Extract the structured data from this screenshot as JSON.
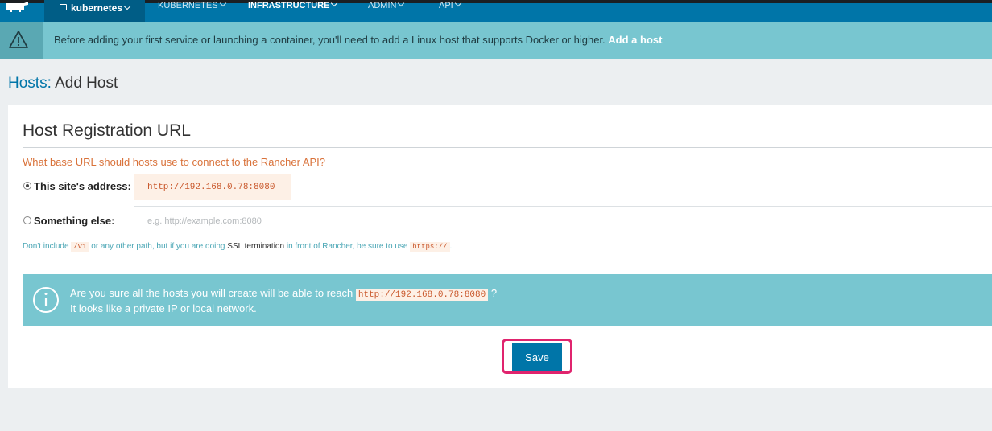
{
  "topnav": {
    "environment": "kubernetes",
    "items": [
      "KUBERNETES",
      "INFRASTRUCTURE",
      "ADMIN",
      "API"
    ],
    "active_item": "INFRASTRUCTURE",
    "colors": {
      "nav": "#0075a8",
      "env": "#005d86"
    }
  },
  "banner": {
    "icon": "warning-triangle-icon",
    "message": "Before adding your first service or launching a container, you'll need to add a Linux host that supports Docker or higher.",
    "link": "Add a host"
  },
  "page": {
    "breadcrumb": "Hosts:",
    "title": "Add Host"
  },
  "registration": {
    "section_title": "Host Registration URL",
    "question": "What base URL should hosts use to connect to the Rancher API?",
    "option_this_site": "This site's address:",
    "this_site_value": "http://192.168.0.78:8080",
    "option_something_else": "Something else:",
    "something_else_placeholder": "e.g. http://example.com:8080",
    "hint_prefix": "Don't include",
    "hint_code_v1": "/v1",
    "hint_middle": "or any other path, but if you are doing",
    "hint_ssl": "SSL termination",
    "hint_suffix": "in front of Rancher, be sure to use",
    "hint_code_https": "https://",
    "hint_end": "."
  },
  "info": {
    "icon": "info-circle-icon",
    "line1_prefix": "Are you sure all the hosts you will create will be able to reach",
    "line1_url": "http://192.168.0.78:8080",
    "line1_suffix": "?",
    "line2": "It looks like a private IP or local network."
  },
  "actions": {
    "save_label": "Save"
  }
}
